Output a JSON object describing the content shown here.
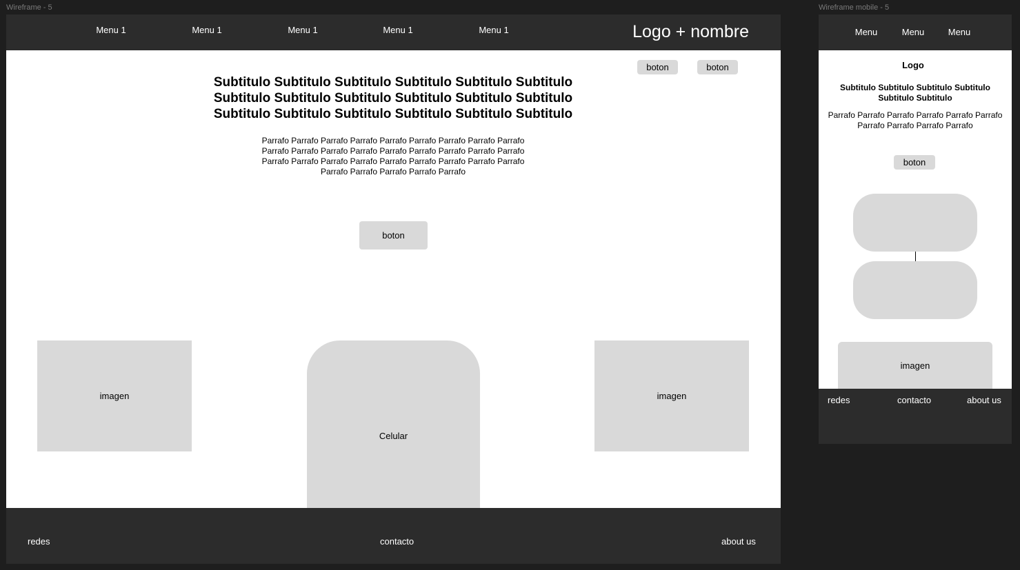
{
  "desktop": {
    "frame_label": "Wireframe - 5",
    "menu": [
      "Menu 1",
      "Menu 1",
      "Menu 1",
      "Menu 1",
      "Menu 1"
    ],
    "logo": "Logo + nombre",
    "header_buttons": [
      "boton",
      "boton"
    ],
    "subtitle": "Subtitulo Subtitulo Subtitulo Subtitulo Subtitulo Subtitulo Subtitulo Subtitulo Subtitulo Subtitulo Subtitulo Subtitulo Subtitulo Subtitulo Subtitulo Subtitulo Subtitulo Subtitulo",
    "paragraph": "Parrafo Parrafo Parrafo Parrafo Parrafo Parrafo Parrafo Parrafo Parrafo Parrafo Parrafo Parrafo Parrafo Parrafo Parrafo Parrafo Parrafo Parrafo Parrafo Parrafo Parrafo Parrafo Parrafo Parrafo Parrafo Parrafo Parrafo Parrafo Parrafo Parrafo Parrafo Parrafo",
    "cta_button": "boton",
    "image_left": "imagen",
    "phone": "Celular",
    "image_right": "imagen",
    "footer": {
      "redes": "redes",
      "contacto": "contacto",
      "about": "about us"
    }
  },
  "mobile": {
    "frame_label": "Wireframe mobile - 5",
    "menu": [
      "Menu",
      "Menu",
      "Menu"
    ],
    "logo": "Logo",
    "subtitle": "Subtitulo Subtitulo Subtitulo Subtitulo Subtitulo Subtitulo",
    "paragraph": "Parrafo Parrafo Parrafo Parrafo Parrafo Parrafo Parrafo Parrafo Parrafo Parrafo",
    "button": "boton",
    "image": "imagen",
    "footer": {
      "redes": "redes",
      "contacto": "contacto",
      "about": "about us"
    }
  },
  "colors": {
    "canvas": "#1e1e1e",
    "bar": "#2c2c2c",
    "placeholder": "#d9d9d9",
    "frame_label": "#7a7a7a"
  }
}
